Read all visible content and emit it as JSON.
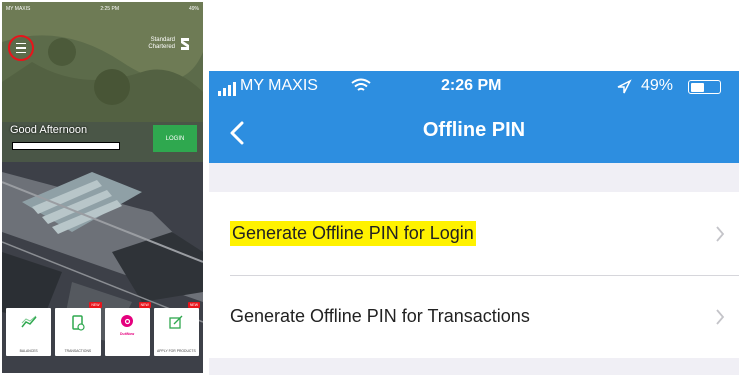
{
  "left_phone": {
    "status": {
      "carrier": "MY MAXIS",
      "time": "2:25 PM",
      "battery": "49%"
    },
    "brand": {
      "line1": "Standard",
      "line2": "Chartered"
    },
    "greeting": "Good Afternoon",
    "login_label": "LOGIN",
    "tiles": [
      {
        "label": "BALANCES",
        "icon": "chart-icon",
        "new": ""
      },
      {
        "label": "TRANSACTIONS",
        "icon": "receipt-icon",
        "new": "NEW"
      },
      {
        "label": "",
        "icon": "duitnow-icon",
        "new": "NEW",
        "brand_text": "DuitNow"
      },
      {
        "label": "APPLY FOR PRODUCTS",
        "icon": "apply-icon",
        "new": "NEW"
      }
    ],
    "highlight_color": "#e8141b"
  },
  "right_phone": {
    "status": {
      "carrier": "MY MAXIS",
      "time": "2:26 PM",
      "battery": "49%"
    },
    "title": "Offline PIN",
    "rows": [
      {
        "label": "Generate Offline PIN for Login",
        "highlighted": true
      },
      {
        "label": "Generate Offline PIN for Transactions",
        "highlighted": false
      }
    ],
    "accent_color": "#2d8ee0",
    "highlight_color": "#fff200"
  }
}
